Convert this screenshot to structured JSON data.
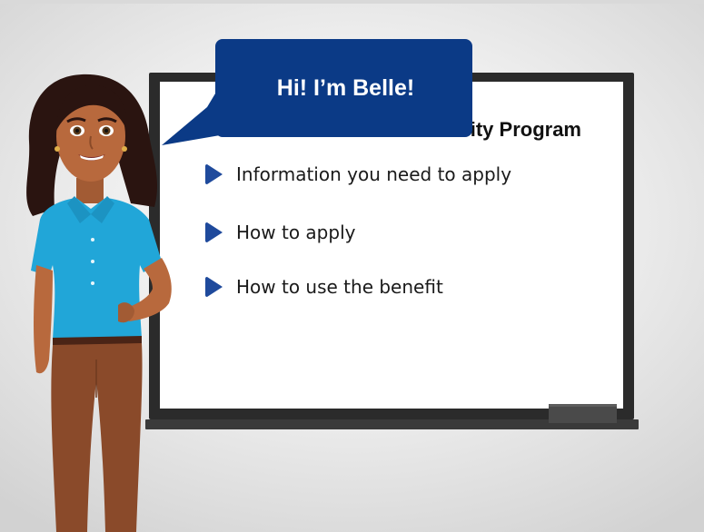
{
  "slide": {
    "board_title": "Affordable Connectivity Program",
    "bullets": [
      {
        "label": "Information you need to apply"
      },
      {
        "label": "How to apply"
      },
      {
        "label": "How to use the benefit"
      }
    ]
  },
  "speech_bubble": {
    "text": "Hi! I’m Belle!"
  },
  "character": {
    "name": "Belle",
    "icon": "presenter-character"
  },
  "colors": {
    "bubble": "#0b3a86",
    "bullet_arrow": "#1f4a9c",
    "board_frame": "#2b2b2b",
    "shirt": "#21a6d8",
    "pants": "#8a4a2a"
  }
}
